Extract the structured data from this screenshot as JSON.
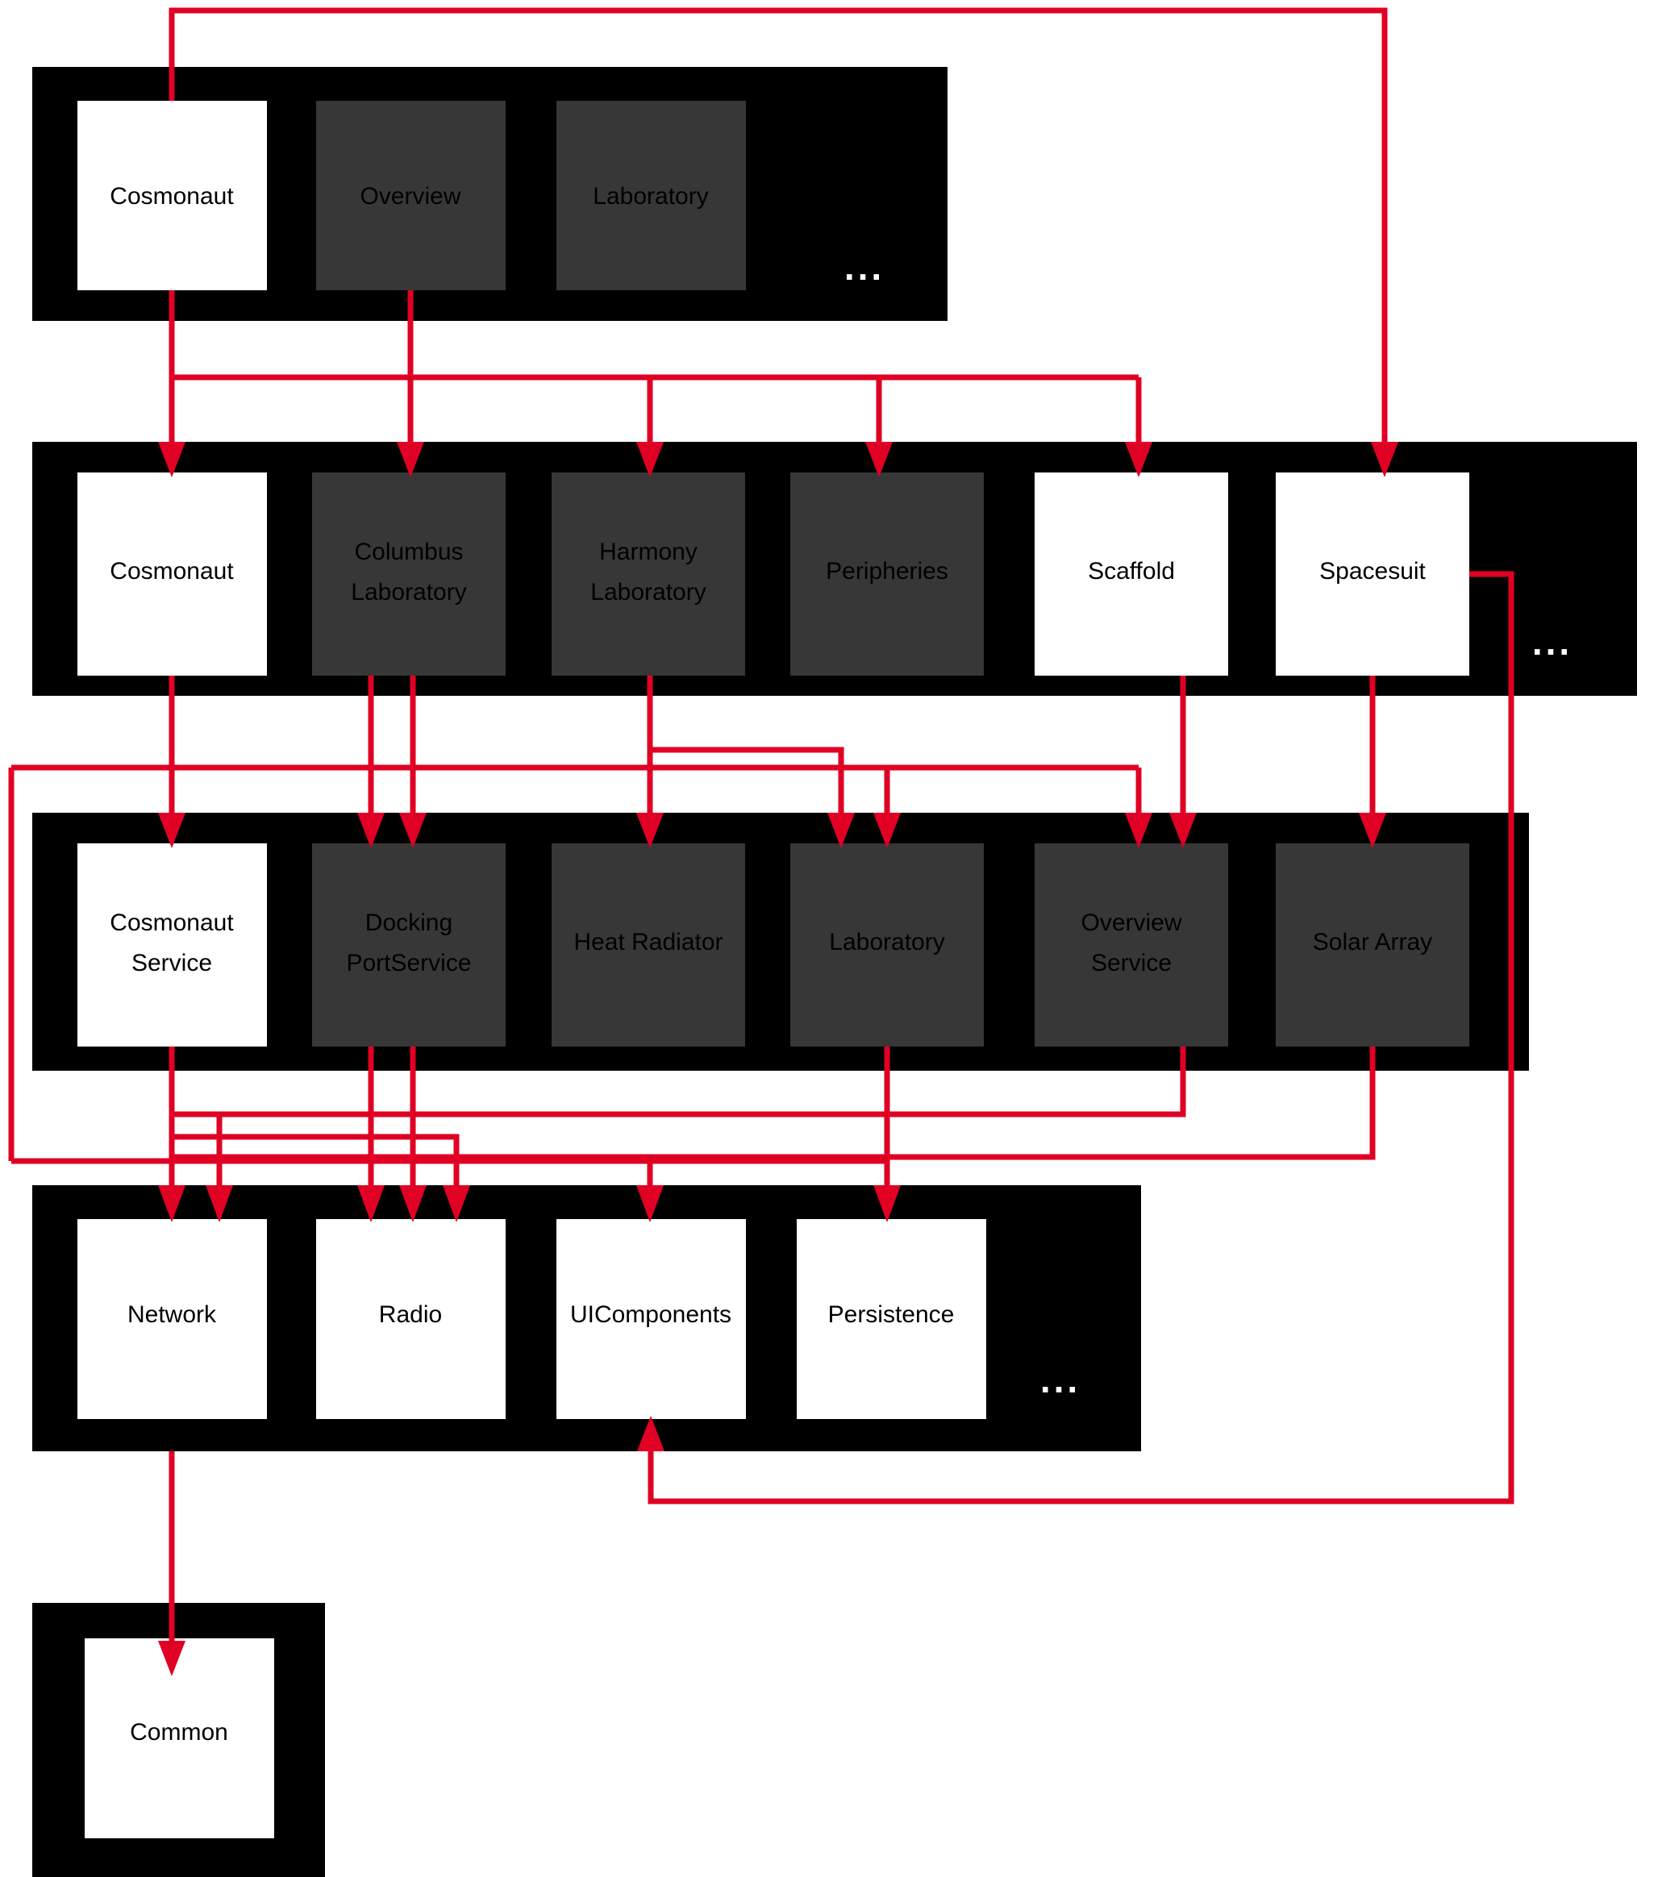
{
  "diagram": {
    "title": "Layered module dependency diagram",
    "colors": {
      "band_background": "#000000",
      "node_light": "#ffffff",
      "node_dark": "#373737",
      "arrow": "#e00024",
      "page_background": "#ffffff",
      "label_text": "#000000",
      "ellipsis_text": "#ffffff"
    },
    "ellipsis_symbol": "...",
    "bands": [
      {
        "id": "band-applications",
        "nodes": [
          {
            "id": "app-cosmonaut",
            "label": "Cosmonaut",
            "style": "light"
          },
          {
            "id": "app-overview",
            "label": "Overview",
            "style": "dark"
          },
          {
            "id": "app-laboratory",
            "label": "Laboratory",
            "style": "dark"
          }
        ],
        "has_ellipsis": true
      },
      {
        "id": "band-features",
        "nodes": [
          {
            "id": "feat-cosmonaut",
            "label": "Cosmonaut",
            "style": "light"
          },
          {
            "id": "feat-columbus-laboratory",
            "label": "Columbus\nLaboratory",
            "style": "dark"
          },
          {
            "id": "feat-harmony-laboratory",
            "label": "Harmony\nLaboratory",
            "style": "dark"
          },
          {
            "id": "feat-peripheries",
            "label": "Peripheries",
            "style": "dark"
          },
          {
            "id": "feat-scaffold",
            "label": "Scaffold",
            "style": "light"
          },
          {
            "id": "feat-spacesuit",
            "label": "Spacesuit",
            "style": "light"
          }
        ],
        "has_ellipsis": true
      },
      {
        "id": "band-services",
        "nodes": [
          {
            "id": "svc-cosmonaut-service",
            "label": "Cosmonaut\nService",
            "style": "light"
          },
          {
            "id": "svc-docking-portservice",
            "label": "Docking\nPortService",
            "style": "dark"
          },
          {
            "id": "svc-heat-radiator",
            "label": "Heat Radiator",
            "style": "dark"
          },
          {
            "id": "svc-laboratory",
            "label": "Laboratory",
            "style": "dark"
          },
          {
            "id": "svc-overview-service",
            "label": "Overview\nService",
            "style": "dark"
          },
          {
            "id": "svc-solar-array",
            "label": "Solar Array",
            "style": "dark"
          }
        ],
        "has_ellipsis": true
      },
      {
        "id": "band-platform",
        "nodes": [
          {
            "id": "plat-network",
            "label": "Network",
            "style": "light"
          },
          {
            "id": "plat-radio",
            "label": "Radio",
            "style": "light"
          },
          {
            "id": "plat-uicomponents",
            "label": "UIComponents",
            "style": "light"
          },
          {
            "id": "plat-persistence",
            "label": "Persistence",
            "style": "light"
          }
        ],
        "has_ellipsis": true
      },
      {
        "id": "band-common",
        "nodes": [
          {
            "id": "common",
            "label": "Common",
            "style": "light"
          }
        ],
        "has_ellipsis": false
      }
    ],
    "edges": [
      {
        "from": "app-cosmonaut",
        "to": "feat-cosmonaut"
      },
      {
        "from": "app-overview",
        "to": "feat-columbus-laboratory"
      },
      {
        "from": "app-cosmonaut",
        "to": "feat-harmony-laboratory"
      },
      {
        "from": "app-cosmonaut",
        "to": "feat-peripheries"
      },
      {
        "from": "app-cosmonaut",
        "to": "feat-scaffold"
      },
      {
        "from": "app-cosmonaut",
        "to": "feat-spacesuit"
      },
      {
        "from": "feat-cosmonaut",
        "to": "svc-cosmonaut-service"
      },
      {
        "from": "feat-columbus-laboratory",
        "to": "svc-docking-portservice"
      },
      {
        "from": "feat-harmony-laboratory",
        "to": "svc-docking-portservice"
      },
      {
        "from": "feat-harmony-laboratory",
        "to": "svc-heat-radiator"
      },
      {
        "from": "feat-harmony-laboratory",
        "to": "svc-laboratory"
      },
      {
        "from": "feat-scaffold",
        "to": "svc-overview-service"
      },
      {
        "from": "feat-spacesuit",
        "to": "svc-solar-array"
      },
      {
        "from": "feat-spacesuit",
        "to": "plat-uicomponents"
      },
      {
        "from": "svc-cosmonaut-service",
        "to": "plat-network"
      },
      {
        "from": "svc-docking-portservice",
        "to": "plat-radio"
      },
      {
        "from": "svc-heat-radiator",
        "to": "plat-radio"
      },
      {
        "from": "svc-laboratory",
        "to": "plat-persistence"
      },
      {
        "from": "svc-overview-service",
        "to": "plat-network"
      },
      {
        "from": "svc-solar-array",
        "to": "plat-radio"
      },
      {
        "from": "svc-solar-array",
        "to": "plat-uicomponents"
      },
      {
        "from": "plat-network",
        "to": "common"
      }
    ]
  }
}
